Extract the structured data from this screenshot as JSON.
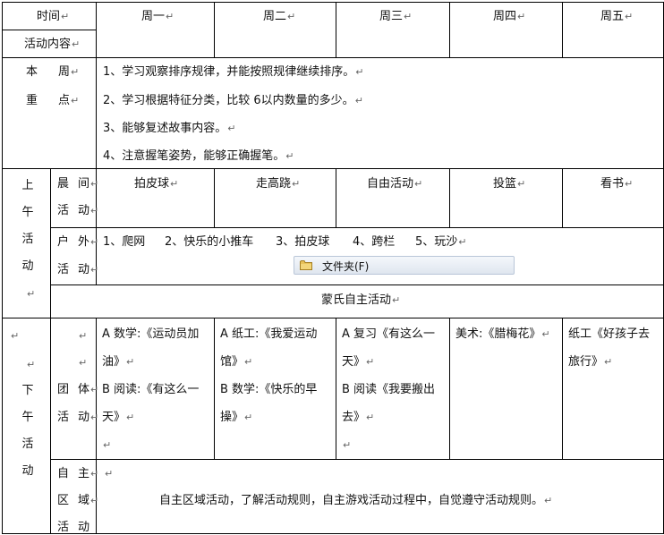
{
  "mark": "↵",
  "header": {
    "time": "时间",
    "content": "活动内容",
    "days": [
      "周一",
      "周二",
      "周三",
      "周四",
      "周五"
    ]
  },
  "weekly_focus": {
    "label_chars": [
      "本",
      "周",
      "重",
      "点"
    ],
    "items": [
      "1、学习观察排序规律，并能按照规律继续排序。",
      "2、学习根据特征分类，比较 6以内数量的多少。",
      "3、能够复述故事内容。",
      "4、注意握笔姿势，能够正确握笔。"
    ]
  },
  "morning": {
    "label_chars": [
      "上",
      "午",
      "活",
      "动"
    ],
    "early": {
      "label_chars": [
        "晨",
        "间",
        "活",
        "动"
      ],
      "days": [
        "拍皮球",
        "走高跷",
        "自由活动",
        "投篮",
        "看书"
      ]
    },
    "outdoor": {
      "label_chars": [
        "户",
        "外",
        "活",
        "动"
      ],
      "items": [
        "1、爬网",
        "2、快乐的小推车",
        "3、拍皮球",
        "4、跨栏",
        "5、玩沙"
      ]
    },
    "montessori": "蒙氏自主活动"
  },
  "afternoon": {
    "label_chars": [
      "下",
      "午",
      "活",
      "动"
    ],
    "group": {
      "label_chars": [
        "团",
        "体",
        "活",
        "动"
      ],
      "mon": {
        "a1": "A 数学:《运动员加",
        "a2": "油》",
        "b1": "B 阅读:《有这么一",
        "b2": "天》"
      },
      "tue": {
        "a1": "A 纸工:《我爱运动",
        "a2": "馆》",
        "b1": "B 数学:《快乐的早",
        "b2": "操》"
      },
      "wed": {
        "a1": "A 复习《有这么一",
        "a2": "天》",
        "b1": "B 阅读《我要搬出",
        "b2": "去》"
      },
      "thu": {
        "a1": "美术:《腊梅花》"
      },
      "fri": {
        "a1": "纸工《好孩子去",
        "a2": "旅行》"
      }
    },
    "free_area": {
      "label_chars": [
        "自",
        "主",
        "区",
        "域",
        "活",
        "动"
      ],
      "text": "自主区域活动，了解活动规则，自主游戏活动过程中，自觉遵守活动规则。"
    }
  },
  "tooltip": {
    "label": "文件夹(F)",
    "icon": "folder-icon"
  }
}
